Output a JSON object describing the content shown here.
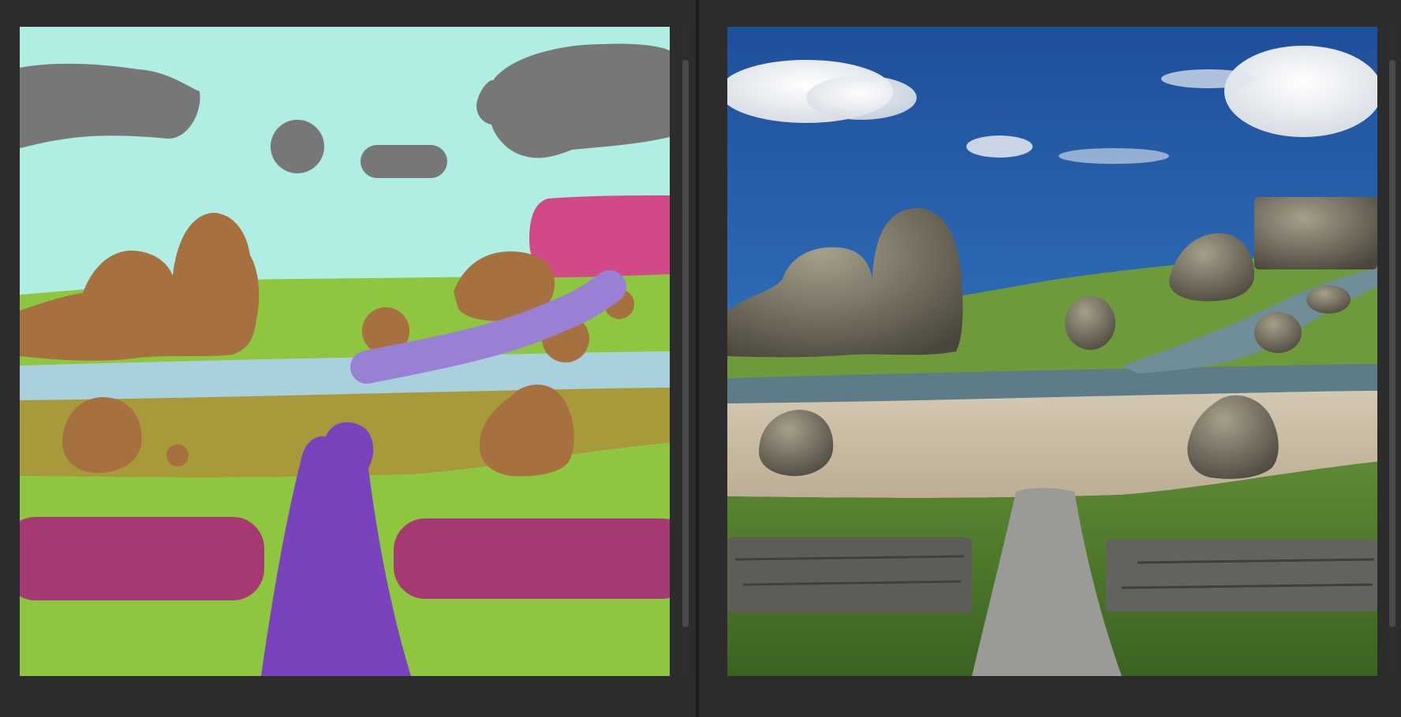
{
  "panels": {
    "sketch": {
      "colors": {
        "sky": "#b0eee3",
        "cloud": "#777777",
        "mountain": "#d14a87",
        "rock": "#a6703f",
        "grass": "#8ec63f",
        "water": "#a9d0dd",
        "river": "#9a80d4",
        "sand": "#a89a3a",
        "path": "#7a43bd",
        "wall": "#a53a72"
      }
    },
    "rendered": {
      "colors": {
        "sky_top": "#1f4f9a",
        "sky_bottom": "#2f6fb8",
        "cloud": "#f3f3f3",
        "rock": "#6e6a5e",
        "grass": "#4e7a2c",
        "water": "#5d7c88",
        "sand": "#cbbfa8",
        "path": "#9a9a96",
        "wall": "#5d5d58"
      }
    }
  }
}
